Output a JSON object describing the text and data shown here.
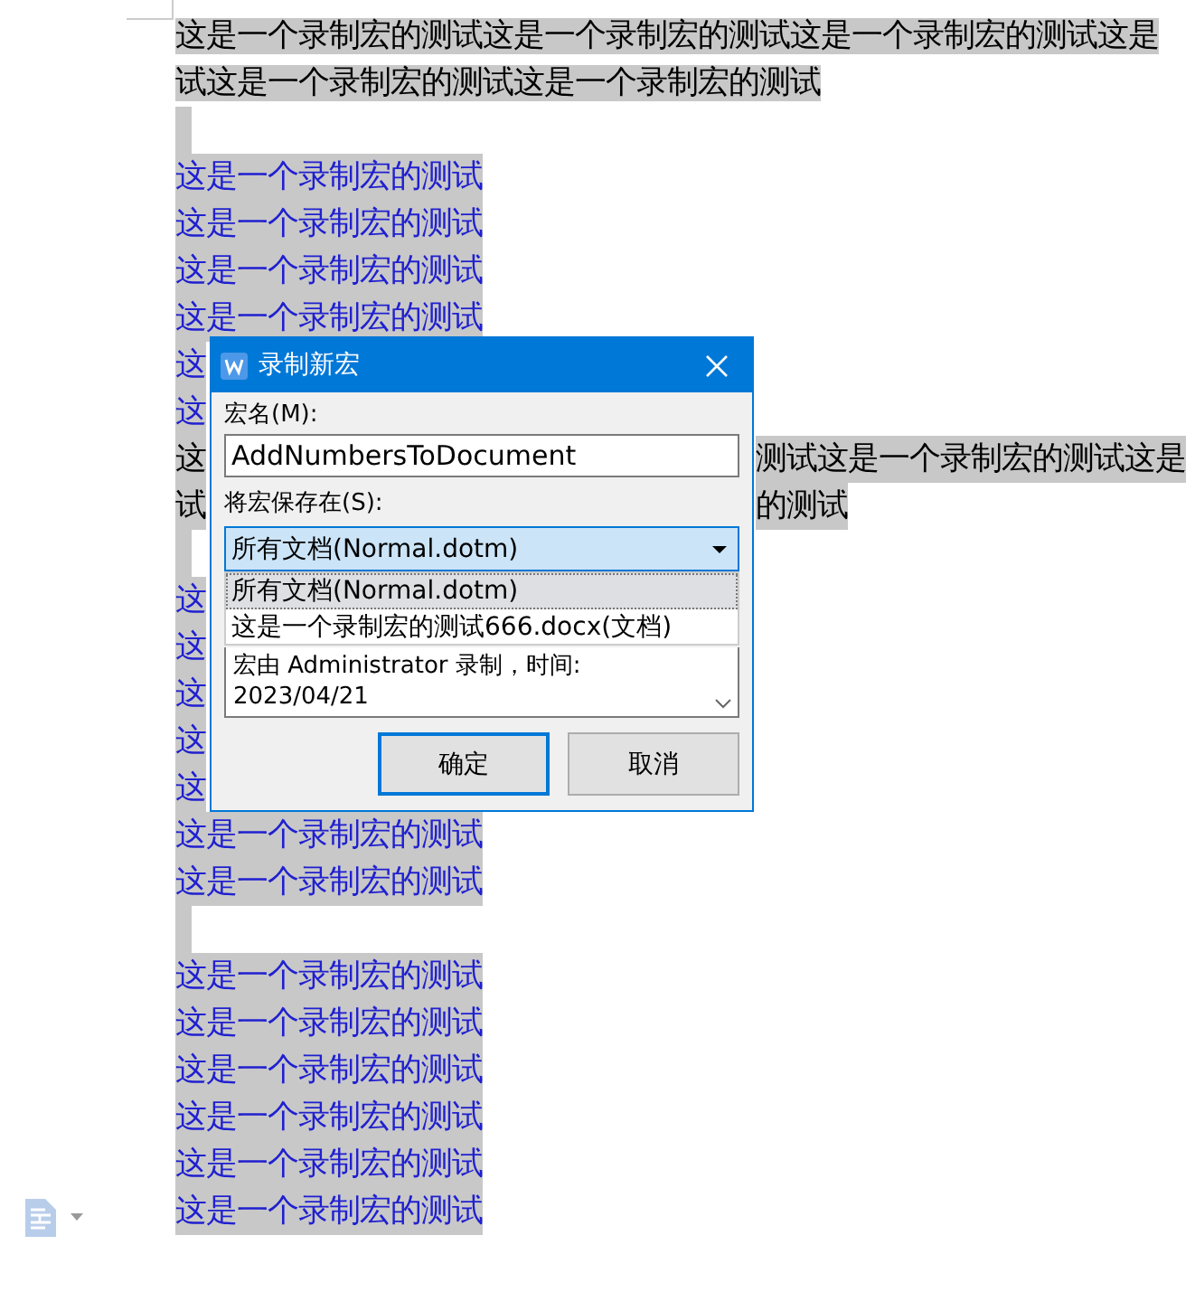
{
  "document": {
    "lines": [
      {
        "kind": "text",
        "color": "#000000",
        "text": "这是一个录制宏的测试这是一个录制宏的测试这是一个录制宏的测试这是"
      },
      {
        "kind": "text",
        "color": "#000000",
        "text": "试这是一个录制宏的测试这是一个录制宏的测试"
      },
      {
        "kind": "blank"
      },
      {
        "kind": "text",
        "color": "#2020d0",
        "text": "这是一个录制宏的测试"
      },
      {
        "kind": "text",
        "color": "#2020d0",
        "text": "这是一个录制宏的测试"
      },
      {
        "kind": "text",
        "color": "#2020d0",
        "text": "这是一个录制宏的测试"
      },
      {
        "kind": "text",
        "color": "#2020d0",
        "text": "这是一个录制宏的测试"
      },
      {
        "kind": "text",
        "color": "#2020d0",
        "text": "这"
      },
      {
        "kind": "text",
        "color": "#2020d0",
        "text": "这"
      },
      {
        "kind": "text",
        "color": "#000000",
        "text": "这",
        "right": "测试这是一个录制宏的测试这是"
      },
      {
        "kind": "text",
        "color": "#000000",
        "text": "试",
        "right": "的测试"
      },
      {
        "kind": "blank"
      },
      {
        "kind": "text",
        "color": "#2020d0",
        "text": "这"
      },
      {
        "kind": "text",
        "color": "#2020d0",
        "text": "这"
      },
      {
        "kind": "text",
        "color": "#2020d0",
        "text": "这"
      },
      {
        "kind": "text",
        "color": "#2020d0",
        "text": "这"
      },
      {
        "kind": "text",
        "color": "#2020d0",
        "text": "这"
      },
      {
        "kind": "text",
        "color": "#2020d0",
        "text": "这是一个录制宏的测试"
      },
      {
        "kind": "text",
        "color": "#2020d0",
        "text": "这是一个录制宏的测试"
      },
      {
        "kind": "blank"
      },
      {
        "kind": "text",
        "color": "#2020d0",
        "text": "这是一个录制宏的测试"
      },
      {
        "kind": "text",
        "color": "#2020d0",
        "text": "这是一个录制宏的测试"
      },
      {
        "kind": "text",
        "color": "#2020d0",
        "text": "这是一个录制宏的测试"
      },
      {
        "kind": "text",
        "color": "#2020d0",
        "text": "这是一个录制宏的测试"
      },
      {
        "kind": "text",
        "color": "#2020d0",
        "text": "这是一个录制宏的测试"
      },
      {
        "kind": "text",
        "color": "#2020d0",
        "text": "这是一个录制宏的测试"
      }
    ]
  },
  "dialog": {
    "title": "录制新宏",
    "name_label": "宏名(M):",
    "name_value": "AddNumbersToDocument",
    "store_label": "将宏保存在(S):",
    "store_value": "所有文档(Normal.dotm)",
    "store_options": [
      {
        "label": "所有文档(Normal.dotm)",
        "selected": true
      },
      {
        "label": "这是一个录制宏的测试666.docx(文档)",
        "selected": false
      }
    ],
    "description": [
      "宏由 Administrator 录制，时间:",
      "2023/04/21"
    ],
    "buttons": [
      {
        "label": "确定",
        "default": true
      },
      {
        "label": "取消",
        "default": false
      }
    ]
  }
}
